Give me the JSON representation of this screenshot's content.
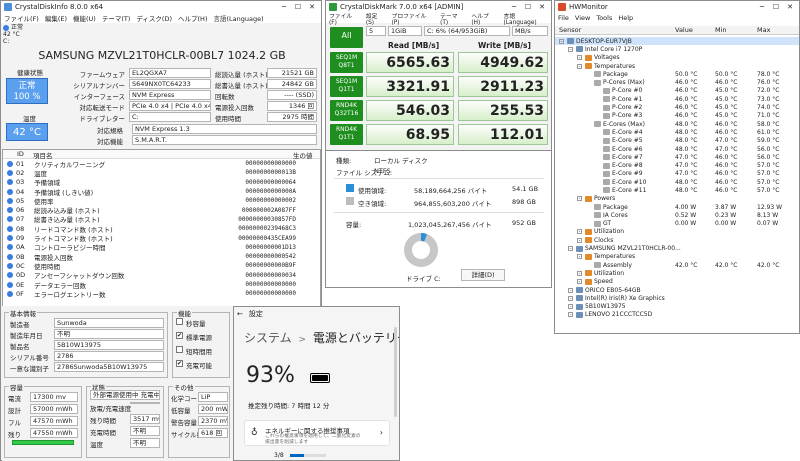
{
  "cdi": {
    "title": "CrystalDiskInfo 8.0.0 x64",
    "menu": [
      "ファイル(F)",
      "編集(E)",
      "機能(U)",
      "テーマ(T)",
      "ディスク(D)",
      "ヘルプ(H)",
      "言語(Language)"
    ],
    "drive_status": "正常",
    "drive_temp": "42 °C",
    "drive_letter": "C:",
    "model": "SAMSUNG MZVL21T0HCLR-00BL7 1024.2 GB",
    "health_label": "健康状態",
    "health_status": "正常",
    "health_pct": "100 %",
    "temp_label": "温度",
    "temp_value": "42 °C",
    "left_fields": [
      {
        "label": "ファームウェア",
        "value": "EL2QGXA7"
      },
      {
        "label": "シリアルナンバー",
        "value": "S649NX0TC64233"
      },
      {
        "label": "インターフェース",
        "value": "NVM Express"
      },
      {
        "label": "対応転送モード",
        "value": "PCIe 4.0 x4 | PCIe 4.0 x4"
      },
      {
        "label": "ドライブレター",
        "value": "C:"
      }
    ],
    "right_fields": [
      {
        "label": "総読込量 (ホスト)",
        "value": "21521 GB"
      },
      {
        "label": "総書込量 (ホスト)",
        "value": "24842 GB"
      },
      {
        "label": "回転数",
        "value": "---- (SSD)"
      },
      {
        "label": "電源投入回数",
        "value": "1346 回"
      },
      {
        "label": "使用時間",
        "value": "2975 時間"
      }
    ],
    "std_label": "対応規格",
    "std_value": "NVM Express 1.3",
    "feat_label": "対応機能",
    "feat_value": "S.M.A.R.T.",
    "smart_headers": [
      "ID",
      "項目名",
      "生の値"
    ],
    "smart_rows": [
      {
        "id": "01",
        "name": "クリティカルワーニング",
        "raw": "00000000000000"
      },
      {
        "id": "02",
        "name": "温度",
        "raw": "0000000000013B"
      },
      {
        "id": "03",
        "name": "予備領域",
        "raw": "00000000000064"
      },
      {
        "id": "04",
        "name": "予備領域 (しきい値)",
        "raw": "0000000000000A"
      },
      {
        "id": "05",
        "name": "使用率",
        "raw": "00000000000002"
      },
      {
        "id": "06",
        "name": "総読み込み量 (ホスト)",
        "raw": "000000002A087FF"
      },
      {
        "id": "07",
        "name": "総書き込み量 (ホスト)",
        "raw": "00000000030857FD"
      },
      {
        "id": "08",
        "name": "リードコマンド数 (ホスト)",
        "raw": "00000000239468C3"
      },
      {
        "id": "09",
        "name": "ライトコマンド数 (ホスト)",
        "raw": "00000000435CEA99"
      },
      {
        "id": "0A",
        "name": "コントローラビジー時間",
        "raw": "00000000001D13"
      },
      {
        "id": "0B",
        "name": "電源投入回数",
        "raw": "00000000000542"
      },
      {
        "id": "0C",
        "name": "使用時間",
        "raw": "00000000000B9F"
      },
      {
        "id": "0D",
        "name": "アンセーフシャットダウン回数",
        "raw": "00000000000034"
      },
      {
        "id": "0E",
        "name": "データエラー回数",
        "raw": "00000000000000"
      },
      {
        "id": "0F",
        "name": "エラーログエントリー数",
        "raw": "00000000000000"
      }
    ]
  },
  "battery": {
    "basic_title": "基本情報",
    "basic": [
      {
        "label": "製造者",
        "value": "Sunwoda"
      },
      {
        "label": "製造年月日",
        "value": "不明"
      },
      {
        "label": "製品名",
        "value": "5B10W13975"
      },
      {
        "label": "シリアル番号",
        "value": "2786"
      },
      {
        "label": "一意な識別子",
        "value": "2786Sunwoda5B10W13975"
      }
    ],
    "func_title": "機能",
    "funcs": [
      {
        "label": "秒容量",
        "checked": false
      },
      {
        "label": "標準電源",
        "checked": true
      },
      {
        "label": "短時間用",
        "checked": false
      },
      {
        "label": "充電可能",
        "checked": true
      }
    ],
    "cap_title": "容量",
    "caps": [
      {
        "label": "電流",
        "value": "17300 mv"
      },
      {
        "label": "設計",
        "value": "57000 mWh"
      },
      {
        "label": "フル",
        "value": "47570 mWh"
      },
      {
        "label": "残り",
        "value": "47550 mWh"
      }
    ],
    "state_title": "状態",
    "state": "外部電源使用中 充電中",
    "states": [
      {
        "label": "放電/充電速度",
        "value": ""
      },
      {
        "label": "残り時間",
        "value": "3517 mw"
      },
      {
        "label": "充電時間",
        "value": "不明"
      },
      {
        "label": "温度",
        "value": "不明"
      }
    ],
    "other_title": "その他",
    "others": [
      {
        "label": "化学コード",
        "value": "LiP"
      },
      {
        "label": "低容量",
        "value": "200 mWh"
      },
      {
        "label": "警告容量",
        "value": "2370 mWh"
      },
      {
        "label": "サイクル数",
        "value": "618 回"
      }
    ]
  },
  "cdm": {
    "title": "CrystalDiskMark 7.0.0 x64 [ADMIN]",
    "menu": [
      "ファイル(F)",
      "設定(S)",
      "プロファイル(P)",
      "テーマ(T)",
      "ヘルプ(H)",
      "言語(Language)"
    ],
    "all_label": "All",
    "count": "5",
    "size": "1GiB",
    "drive": "C: 6% (64/953GiB)",
    "unit": "MB/s",
    "read_label": "Read [MB/s]",
    "write_label": "Write [MB/s]",
    "tests": [
      {
        "l1": "SEQ1M",
        "l2": "Q8T1",
        "read": "6565.63",
        "write": "4949.62"
      },
      {
        "l1": "SEQ1M",
        "l2": "Q1T1",
        "read": "3321.91",
        "write": "2911.23"
      },
      {
        "l1": "RND4K",
        "l2": "Q32T16",
        "read": "546.03",
        "write": "255.53"
      },
      {
        "l1": "RND4K",
        "l2": "Q1T1",
        "read": "68.95",
        "write": "112.01"
      }
    ]
  },
  "props": {
    "type_label": "種類:",
    "type_value": "ローカル ディスク",
    "fs_label": "ファイル システム:",
    "fs_value": "NTFS",
    "used_label": "使用領域:",
    "used_bytes": "58,189,664,256 バイト",
    "used_gb": "54.1 GB",
    "free_label": "空き領域:",
    "free_bytes": "964,855,603,200 バイト",
    "free_gb": "898 GB",
    "cap_label": "容量:",
    "cap_bytes": "1,023,045,267,456 バイト",
    "cap_gb": "952 GB",
    "drive_label": "ドライブ C:",
    "detail_btn": "詳細(D)",
    "used_fraction": 0.057
  },
  "settings": {
    "title": "設定",
    "crumb_parent": "システム",
    "crumb_sep": ">",
    "crumb_current": "電源とバッテリー",
    "battery_pct": "93%",
    "remaining": "推定残り時間: 7 時間 12 分",
    "rec_title": "エネルギーに関する推奨事項",
    "rec_desc": "これらの推奨事項を適用して、二酸化炭素の排出量を削減します",
    "progress": "3/8"
  },
  "hw": {
    "title": "HWMonitor",
    "menu": [
      "File",
      "View",
      "Tools",
      "Help"
    ],
    "headers": [
      "Sensor",
      "Value",
      "Min",
      "Max"
    ],
    "rows": [
      {
        "lv": 0,
        "t": "DESKTOP-EUR7VJB",
        "v": "",
        "mn": "",
        "mx": "",
        "sel": true
      },
      {
        "lv": 1,
        "t": "Intel Core i7 1270P",
        "v": "",
        "mn": "",
        "mx": ""
      },
      {
        "lv": 2,
        "t": "Voltages",
        "v": "",
        "mn": "",
        "mx": ""
      },
      {
        "lv": 2,
        "t": "Temperatures",
        "v": "",
        "mn": "",
        "mx": ""
      },
      {
        "lv": 3,
        "t": "Package",
        "v": "50.0 °C",
        "mn": "50.0 °C",
        "mx": "78.0 °C"
      },
      {
        "lv": 3,
        "t": "P-Cores (Max)",
        "v": "46.0 °C",
        "mn": "46.0 °C",
        "mx": "76.0 °C"
      },
      {
        "lv": 4,
        "t": "P-Core #0",
        "v": "46.0 °C",
        "mn": "45.0 °C",
        "mx": "72.0 °C"
      },
      {
        "lv": 4,
        "t": "P-Core #1",
        "v": "46.0 °C",
        "mn": "45.0 °C",
        "mx": "73.0 °C"
      },
      {
        "lv": 4,
        "t": "P-Core #2",
        "v": "46.0 °C",
        "mn": "45.0 °C",
        "mx": "74.0 °C"
      },
      {
        "lv": 4,
        "t": "P-Core #3",
        "v": "46.0 °C",
        "mn": "45.0 °C",
        "mx": "71.0 °C"
      },
      {
        "lv": 3,
        "t": "E-Cores (Max)",
        "v": "48.0 °C",
        "mn": "46.0 °C",
        "mx": "58.0 °C"
      },
      {
        "lv": 4,
        "t": "E-Core #4",
        "v": "48.0 °C",
        "mn": "46.0 °C",
        "mx": "61.0 °C"
      },
      {
        "lv": 4,
        "t": "E-Core #5",
        "v": "48.0 °C",
        "mn": "47.0 °C",
        "mx": "59.0 °C"
      },
      {
        "lv": 4,
        "t": "E-Core #6",
        "v": "48.0 °C",
        "mn": "47.0 °C",
        "mx": "56.0 °C"
      },
      {
        "lv": 4,
        "t": "E-Core #7",
        "v": "47.0 °C",
        "mn": "46.0 °C",
        "mx": "56.0 °C"
      },
      {
        "lv": 4,
        "t": "E-Core #8",
        "v": "47.0 °C",
        "mn": "46.0 °C",
        "mx": "57.0 °C"
      },
      {
        "lv": 4,
        "t": "E-Core #9",
        "v": "47.0 °C",
        "mn": "46.0 °C",
        "mx": "57.0 °C"
      },
      {
        "lv": 4,
        "t": "E-Core #10",
        "v": "48.0 °C",
        "mn": "46.0 °C",
        "mx": "57.0 °C"
      },
      {
        "lv": 4,
        "t": "E-Core #11",
        "v": "48.0 °C",
        "mn": "46.0 °C",
        "mx": "57.0 °C"
      },
      {
        "lv": 2,
        "t": "Powers",
        "v": "",
        "mn": "",
        "mx": ""
      },
      {
        "lv": 3,
        "t": "Package",
        "v": "4.00 W",
        "mn": "3.87 W",
        "mx": "12.93 W"
      },
      {
        "lv": 3,
        "t": "IA Cores",
        "v": "0.52 W",
        "mn": "0.23 W",
        "mx": "8.13 W"
      },
      {
        "lv": 3,
        "t": "GT",
        "v": "0.00 W",
        "mn": "0.00 W",
        "mx": "0.07 W"
      },
      {
        "lv": 2,
        "t": "Utilization",
        "v": "",
        "mn": "",
        "mx": ""
      },
      {
        "lv": 2,
        "t": "Clocks",
        "v": "",
        "mn": "",
        "mx": ""
      },
      {
        "lv": 1,
        "t": "SAMSUNG MZVL21T0HCLR-00...",
        "v": "",
        "mn": "",
        "mx": ""
      },
      {
        "lv": 2,
        "t": "Temperatures",
        "v": "",
        "mn": "",
        "mx": ""
      },
      {
        "lv": 3,
        "t": "Assembly",
        "v": "42.0 °C",
        "mn": "42.0 °C",
        "mx": "42.0 °C"
      },
      {
        "lv": 2,
        "t": "Utilization",
        "v": "",
        "mn": "",
        "mx": ""
      },
      {
        "lv": 2,
        "t": "Speed",
        "v": "",
        "mn": "",
        "mx": ""
      },
      {
        "lv": 1,
        "t": "ORICO    EB05-64GB",
        "v": "",
        "mn": "",
        "mx": ""
      },
      {
        "lv": 1,
        "t": "Intel(R) Iris(R) Xe Graphics",
        "v": "",
        "mn": "",
        "mx": ""
      },
      {
        "lv": 1,
        "t": "5B10W13975",
        "v": "",
        "mn": "",
        "mx": ""
      },
      {
        "lv": 1,
        "t": "LENOVO 21CCCTCC5D",
        "v": "",
        "mn": "",
        "mx": ""
      }
    ]
  }
}
